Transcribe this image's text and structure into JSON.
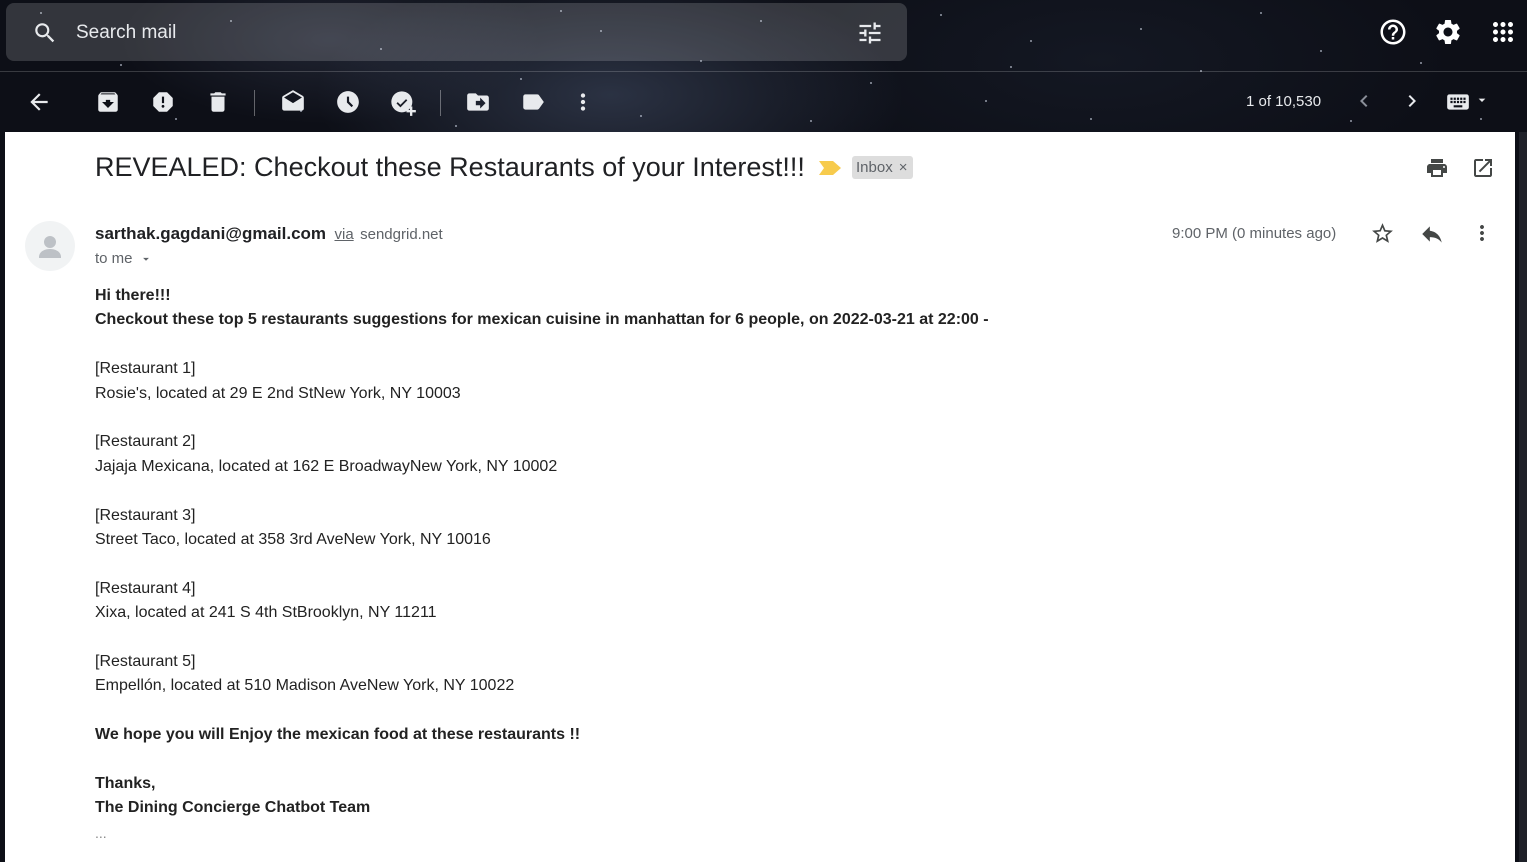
{
  "search": {
    "placeholder": "Search mail"
  },
  "toolbar": {
    "pager": "1 of 10,530"
  },
  "email": {
    "subject": "REVEALED: Checkout these Restaurants of your Interest!!!",
    "label": "Inbox",
    "label_remove": "×",
    "sender": "sarthak.gagdani@gmail.com",
    "via": "via",
    "via_domain": "sendgrid.net",
    "to": "to me",
    "time": "9:00 PM (0 minutes ago)",
    "greeting": "Hi there!!!",
    "intro": "Checkout these top 5 restaurants suggestions for mexican cuisine in manhattan for 6 people, on 2022-03-21 at 22:00 -",
    "restaurants": [
      {
        "heading": "[Restaurant 1]",
        "line": "Rosie's, located at 29 E 2nd StNew York, NY 10003"
      },
      {
        "heading": "[Restaurant 2]",
        "line": "Jajaja Mexicana, located at 162 E BroadwayNew York, NY 10002"
      },
      {
        "heading": "[Restaurant 3]",
        "line": "Street Taco, located at 358 3rd AveNew York, NY 10016"
      },
      {
        "heading": "[Restaurant 4]",
        "line": "Xixa, located at 241 S 4th StBrooklyn, NY 11211"
      },
      {
        "heading": "[Restaurant 5]",
        "line": "Empellón, located at 510 Madison AveNew York, NY 10022"
      }
    ],
    "closing": "We hope you will Enjoy the mexican food at these restaurants !!",
    "thanks": "Thanks,",
    "team": "The Dining Concierge Chatbot Team",
    "trimmed": "..."
  },
  "icons": [
    "search-icon",
    "tune-icon",
    "help-icon",
    "settings-icon",
    "apps-icon",
    "back-arrow-icon",
    "archive-icon",
    "report-spam-icon",
    "delete-icon",
    "mark-unread-icon",
    "snooze-icon",
    "add-task-icon",
    "move-to-icon",
    "label-icon",
    "more-vert-icon",
    "chevron-left-icon",
    "chevron-right-icon",
    "keyboard-icon",
    "caret-down-icon",
    "importance-marker-icon",
    "print-icon",
    "open-new-window-icon",
    "star-icon",
    "reply-icon",
    "more-options-icon",
    "avatar-person-icon"
  ],
  "colors": {
    "importance": "#f7cb4d",
    "panel": "#ffffff",
    "label_chip": "#dddddd"
  }
}
